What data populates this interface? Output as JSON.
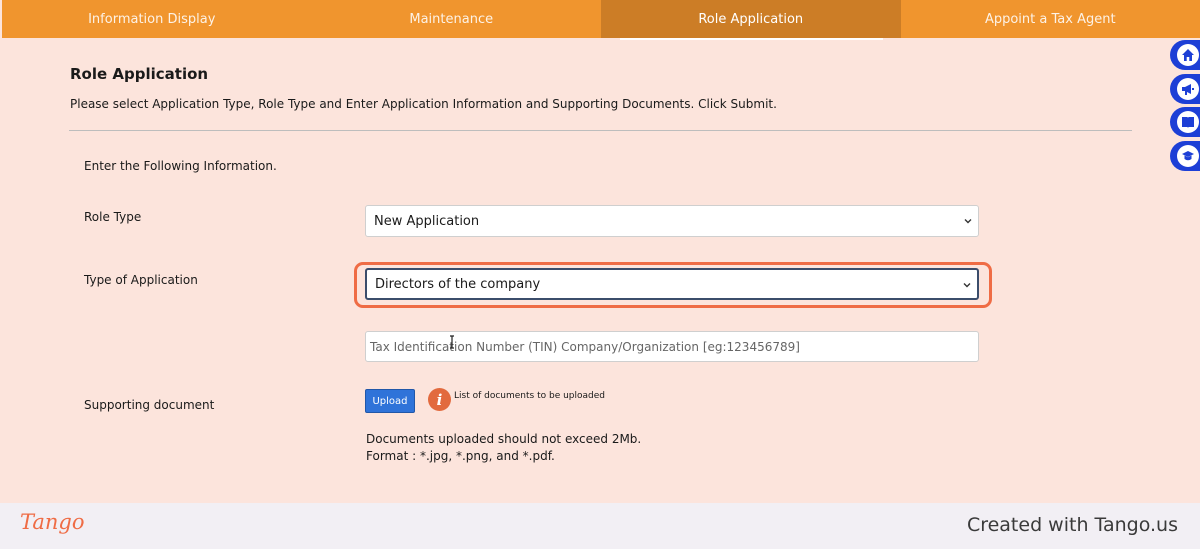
{
  "tabs": [
    {
      "label": "Information Display"
    },
    {
      "label": "Maintenance"
    },
    {
      "label": "Role Application"
    },
    {
      "label": "Appoint a Tax Agent"
    }
  ],
  "active_tab": "Role Application",
  "side_icons": [
    "home-icon",
    "megaphone-icon",
    "book-icon",
    "graduation-cap-icon"
  ],
  "page": {
    "title": "Role Application",
    "instructions": "Please select Application Type, Role Type and Enter Application Information and Supporting Documents. Click Submit."
  },
  "form": {
    "section_title": "Enter the Following Information.",
    "role_type_label": "Role Type",
    "role_type_value": "New Application",
    "application_type_label": "Type of Application",
    "application_type_value": "Directors of the company",
    "tin_placeholder": "Tax Identification Number (TIN) Company/Organization [eg:123456789]",
    "supporting_label": "Supporting document",
    "upload_label": "Upload",
    "info_text": "List of documents to be uploaded",
    "note_size": "Documents uploaded should not exceed 2Mb.",
    "note_format": "Format : *.jpg, *.png, and *.pdf."
  },
  "footer": {
    "logo": "Tango",
    "created_text": "Created with Tango.us"
  },
  "colors": {
    "tab_bar": "#f0952e",
    "tab_active": "#cc7d26",
    "page_bg": "#fce4dc",
    "highlight": "#ef6c45",
    "upload_button": "#2f73d9",
    "side_icon": "#1d3fd6"
  }
}
